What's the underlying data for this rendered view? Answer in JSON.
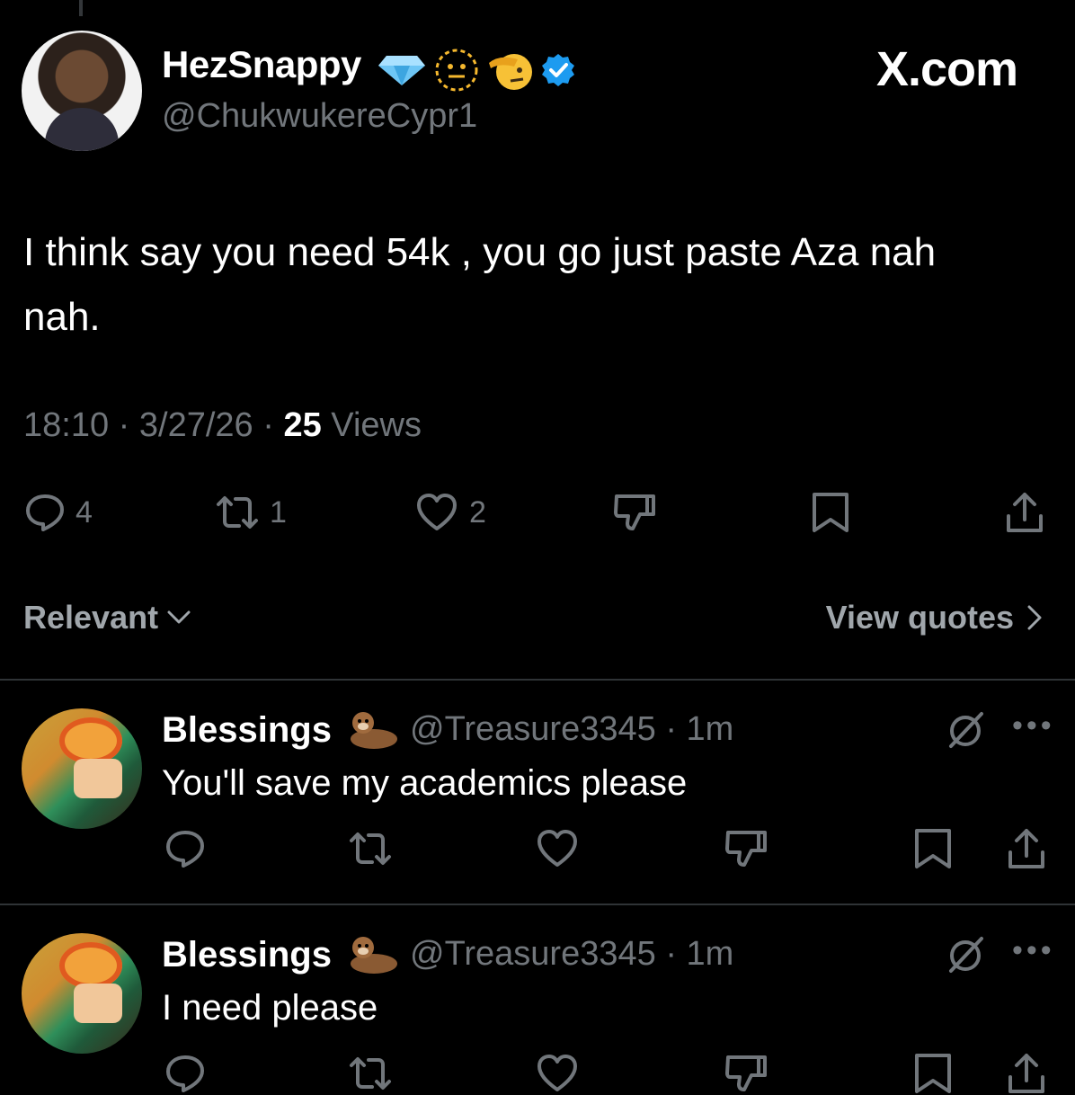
{
  "header": {
    "display_name": "HezSnappy",
    "handle": "@ChukwukereCypr1",
    "brand": "X.com"
  },
  "tweet": {
    "text": "I think say you need 54k , you go just paste Aza nah nah.",
    "time": "18:10",
    "date": "3/27/26",
    "views_count": "25",
    "views_label": "Views",
    "replies": "4",
    "reposts": "1",
    "likes": "2"
  },
  "sort_bar": {
    "sort_label": "Relevant",
    "quotes_label": "View quotes"
  },
  "replies": [
    {
      "name": "Blessings",
      "handle": "@Treasure3345",
      "time": "1m",
      "text": "You'll save my academics please"
    },
    {
      "name": "Blessings",
      "handle": "@Treasure3345",
      "time": "1m",
      "text": "I need please"
    }
  ],
  "colors": {
    "background": "#000000",
    "text_primary": "#e7e9ea",
    "text_secondary": "#71767b",
    "verified": "#1d9bf0",
    "divider": "#2f3336"
  }
}
